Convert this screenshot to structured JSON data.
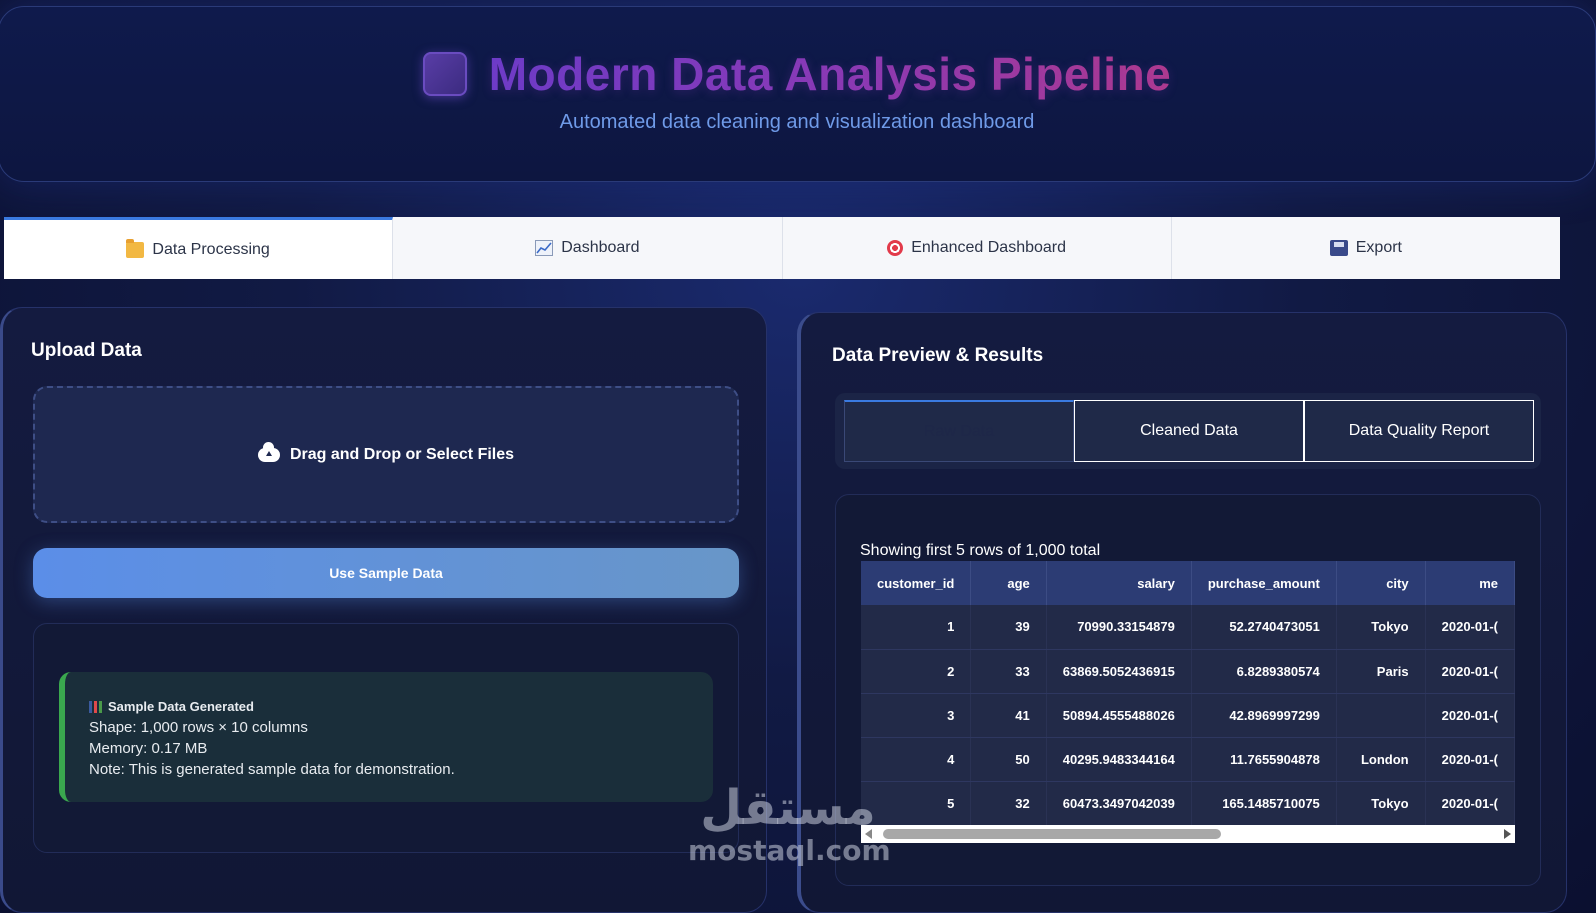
{
  "header": {
    "title": "Modern Data Analysis Pipeline",
    "subtitle": "Automated data cleaning and visualization dashboard",
    "logo_icon": "purple-square-icon"
  },
  "main_tabs": [
    {
      "label": "Data Processing",
      "icon": "folder-icon",
      "active": true
    },
    {
      "label": "Dashboard",
      "icon": "chart-icon",
      "active": false
    },
    {
      "label": "Enhanced Dashboard",
      "icon": "target-icon",
      "active": false
    },
    {
      "label": "Export",
      "icon": "floppy-disk-icon",
      "active": false
    }
  ],
  "upload": {
    "title": "Upload Data",
    "dropzone_label": "Drag and Drop or Select Files",
    "sample_button": "Use Sample Data",
    "alert": {
      "title": "Sample Data Generated",
      "shape": "Shape: 1,000 rows × 10 columns",
      "memory": "Memory: 0.17 MB",
      "note": "Note: This is generated sample data for demonstration."
    }
  },
  "preview": {
    "title": "Data Preview & Results",
    "subtabs": [
      {
        "label": "Raw Data",
        "active": true
      },
      {
        "label": "Cleaned Data",
        "active": false
      },
      {
        "label": "Data Quality Report",
        "active": false
      }
    ],
    "caption": "Showing first 5 rows of 1,000 total",
    "columns": [
      "customer_id",
      "age",
      "salary",
      "purchase_amount",
      "city",
      "me"
    ],
    "rows": [
      [
        "1",
        "39",
        "70990.33154879",
        "52.2740473051",
        "Tokyo",
        "2020-01-("
      ],
      [
        "2",
        "33",
        "63869.5052436915",
        "6.8289380574",
        "Paris",
        "2020-01-("
      ],
      [
        "3",
        "41",
        "50894.4555488026",
        "42.8969997299",
        "",
        "2020-01-("
      ],
      [
        "4",
        "50",
        "40295.9483344164",
        "11.7655904878",
        "London",
        "2020-01-("
      ],
      [
        "5",
        "32",
        "60473.3497042039",
        "165.1485710075",
        "Tokyo",
        "2020-01-("
      ]
    ]
  },
  "watermark": {
    "arabic": "مستقل",
    "latin": "mostaql.com"
  },
  "colors": {
    "accent": "#3a7ae0",
    "title_gradient_start": "#6a3cc8",
    "title_gradient_end": "#b23a8a",
    "success": "#3aa84e",
    "subtitle": "#6f9ae8"
  }
}
